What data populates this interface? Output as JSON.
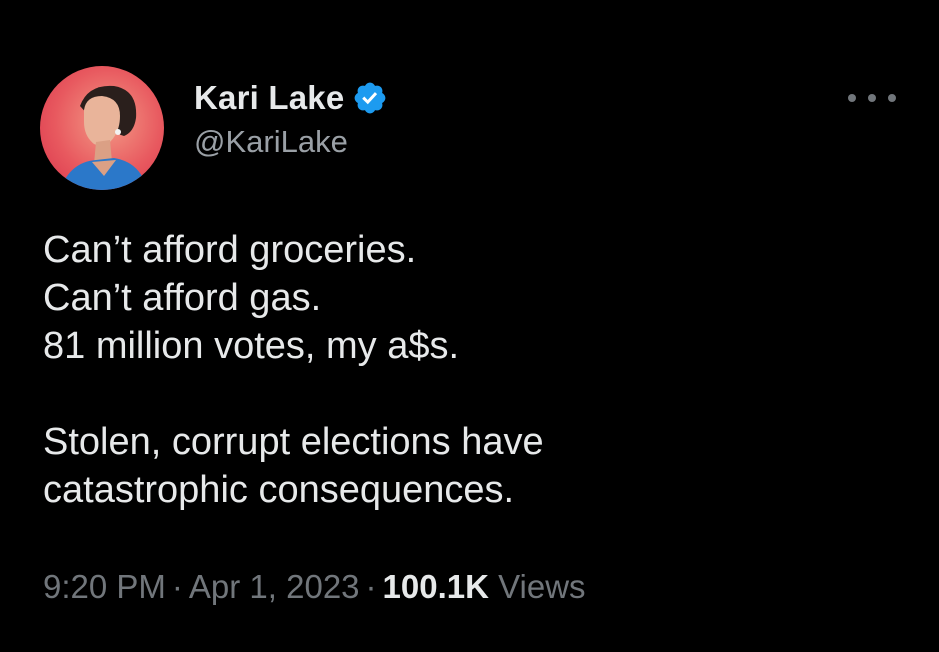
{
  "author": {
    "name": "Kari Lake",
    "handle": "@KariLake",
    "verified": true,
    "verified_color": "#1d9bf0"
  },
  "tweet": {
    "lines": [
      "Can’t afford groceries.",
      "Can’t afford gas.",
      "81 million votes, my a$s.",
      "",
      "Stolen, corrupt elections have",
      "catastrophic consequences."
    ]
  },
  "meta": {
    "time": "9:20 PM",
    "date": "Apr 1, 2023",
    "separator": "·",
    "views_count": "100.1K",
    "views_label": "Views"
  },
  "icons": {
    "more": "more-horizontal-icon",
    "verified": "verified-badge-icon",
    "avatar": "profile-photo"
  },
  "colors": {
    "background": "#000000",
    "text": "#e7e9ea",
    "secondary_text": "#71767b"
  }
}
